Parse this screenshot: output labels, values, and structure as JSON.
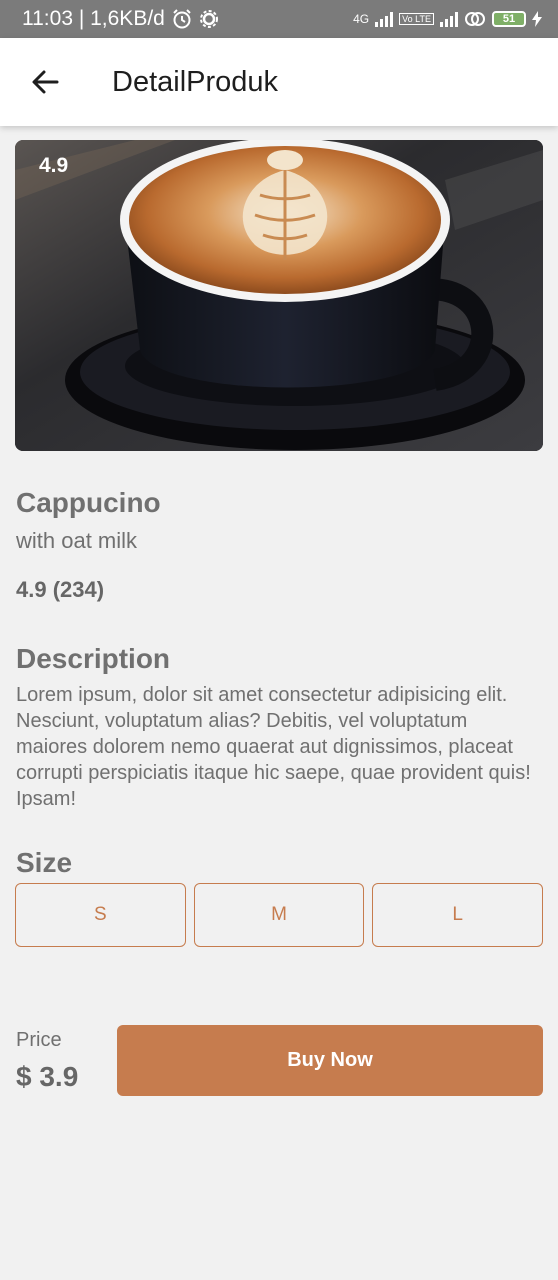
{
  "status_bar": {
    "time_info": "11:03 | 1,6KB/d",
    "network": "4G",
    "volte": "Vo LTE",
    "battery": "51"
  },
  "app_bar": {
    "title": "DetailProduk",
    "back_icon": "arrow-left-icon"
  },
  "product": {
    "image_rating": "4.9",
    "name": "Cappucino",
    "variant": "with oat milk",
    "rating_text": "4.9 (234)",
    "description_heading": "Description",
    "description": "Lorem ipsum, dolor sit amet consectetur adipisicing elit. Nesciunt, voluptatum alias? Debitis, vel voluptatum maiores dolorem nemo quaerat aut dignissimos, placeat corrupti perspiciatis itaque hic saepe, quae provident quis! Ipsam!",
    "size_heading": "Size",
    "sizes": [
      "S",
      "M",
      "L"
    ],
    "price_label": "Price",
    "price": "$ 3.9",
    "buy_label": "Buy Now"
  },
  "colors": {
    "accent": "#C67C4E",
    "text_muted": "#707070",
    "background": "#F1F1F1"
  }
}
